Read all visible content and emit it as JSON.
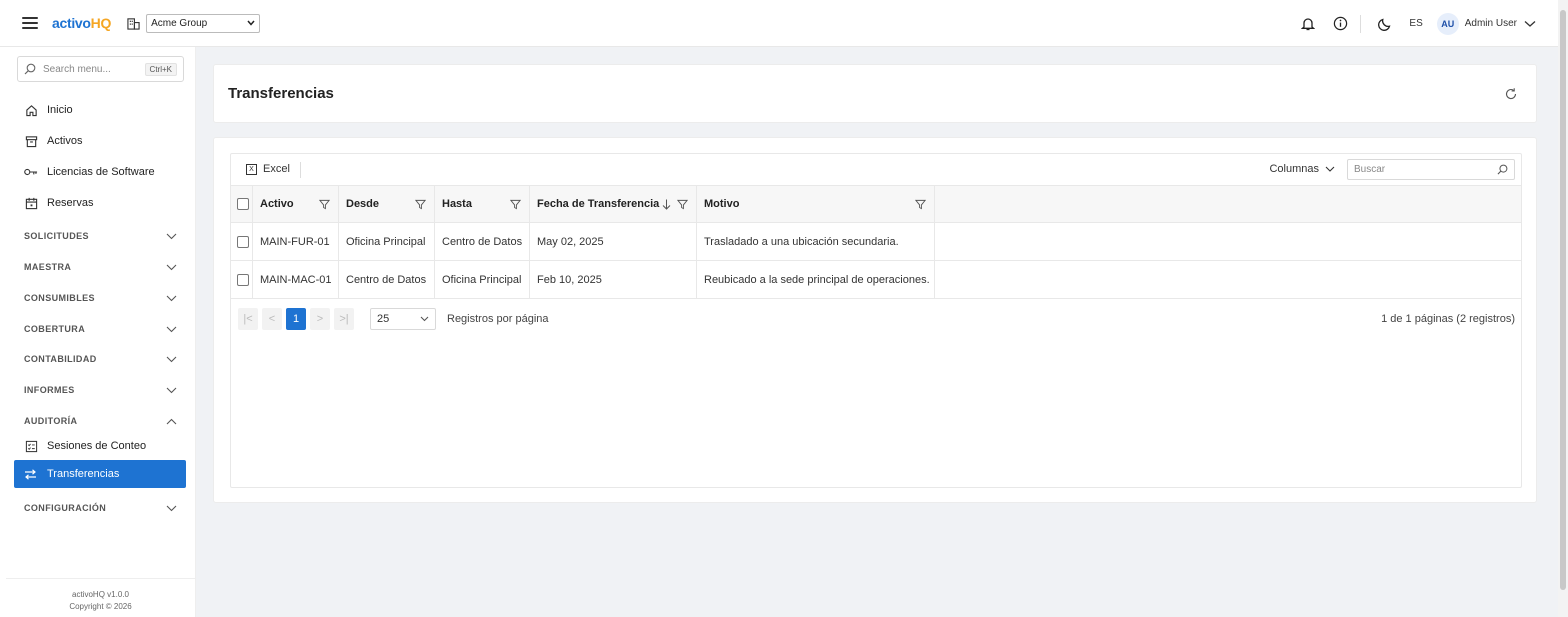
{
  "header": {
    "logo_part1": "activo",
    "logo_part2": "HQ",
    "company_select": "Acme Group",
    "language": "ES",
    "avatar_initials": "AU",
    "user_name": "Admin User"
  },
  "sidebar": {
    "search_placeholder": "Search menu...",
    "search_shortcut": "Ctrl+K",
    "items": [
      {
        "label": "Inicio",
        "icon": "home-icon"
      },
      {
        "label": "Activos",
        "icon": "archive-icon"
      },
      {
        "label": "Licencias de Software",
        "icon": "key-icon"
      },
      {
        "label": "Reservas",
        "icon": "calendar-icon"
      }
    ],
    "sections": [
      {
        "label": "SOLICITUDES",
        "expanded": false
      },
      {
        "label": "MAESTRA",
        "expanded": false
      },
      {
        "label": "CONSUMIBLES",
        "expanded": false
      },
      {
        "label": "COBERTURA",
        "expanded": false
      },
      {
        "label": "CONTABILIDAD",
        "expanded": false
      },
      {
        "label": "INFORMES",
        "expanded": false
      },
      {
        "label": "AUDITORÍA",
        "expanded": true
      },
      {
        "label": "CONFIGURACIÓN",
        "expanded": false
      }
    ],
    "audit_items": [
      {
        "label": "Sesiones de Conteo",
        "icon": "checklist-icon"
      },
      {
        "label": "Transferencias",
        "icon": "transfer-icon",
        "active": true
      }
    ],
    "footer_version": "activoHQ v1.0.0",
    "footer_copyright": "Copyright © 2026"
  },
  "page": {
    "title": "Transferencias"
  },
  "grid": {
    "excel_label": "Excel",
    "columns_label": "Columnas",
    "search_placeholder": "Buscar",
    "headers": [
      "Activo",
      "Desde",
      "Hasta",
      "Fecha de Transferencia",
      "Motivo"
    ],
    "rows": [
      {
        "activo": "MAIN-FUR-01",
        "desde": "Oficina Principal",
        "hasta": "Centro de Datos",
        "fecha": "May 02, 2025",
        "motivo": "Trasladado a una ubicación secundaria."
      },
      {
        "activo": "MAIN-MAC-01",
        "desde": "Centro de Datos",
        "hasta": "Oficina Principal",
        "fecha": "Feb 10, 2025",
        "motivo": "Reubicado a la sede principal de operaciones."
      }
    ],
    "pager": {
      "current_page": "1",
      "page_size": "25",
      "page_size_label": "Registros por página",
      "info": "1 de 1 páginas (2 registros)"
    }
  },
  "colors": {
    "primary": "#1e73d2",
    "logo_accent": "#f5a623"
  }
}
